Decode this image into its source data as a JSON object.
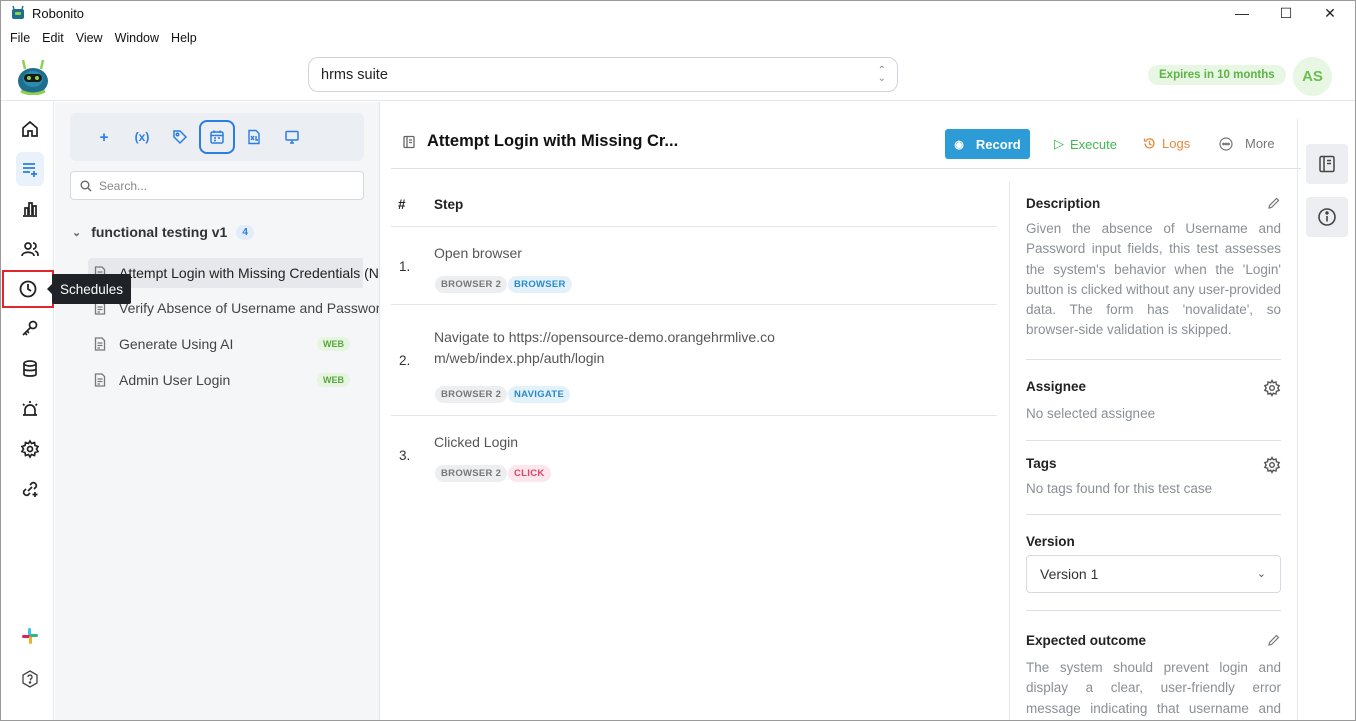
{
  "window": {
    "title": "Robonito",
    "minimize": "—",
    "maximize": "☐",
    "close": "✕"
  },
  "menu": [
    "File",
    "Edit",
    "View",
    "Window",
    "Help"
  ],
  "header": {
    "suite_value": "hrms suite",
    "expires": "Expires in 10 months",
    "avatar": "AS"
  },
  "rail": {
    "tooltip": "Schedules"
  },
  "tree": {
    "search_placeholder": "Search...",
    "group": {
      "name": "functional testing v1",
      "count": "4"
    },
    "items": [
      {
        "label": "Attempt Login with Missing Credentials (No",
        "badge": ""
      },
      {
        "label": "Verify Absence of Username and Password",
        "badge": ""
      },
      {
        "label": "Generate Using AI",
        "badge": "WEB"
      },
      {
        "label": "Admin User Login",
        "badge": "WEB"
      }
    ],
    "toolbar": {
      "add": "+",
      "variable": "(x)"
    }
  },
  "main": {
    "title": "Attempt Login with Missing Cr...",
    "record": "Record",
    "execute": "Execute",
    "logs": "Logs",
    "more": "More",
    "col_num": "#",
    "col_step": "Step",
    "steps": [
      {
        "num": "1.",
        "text": "Open browser",
        "chip1": "BROWSER 2",
        "chip2": "BROWSER"
      },
      {
        "num": "2.",
        "text": "Navigate to https://opensource-demo.orangehrmlive.com/web/index.php/auth/login",
        "chip1": "BROWSER 2",
        "chip2": "NAVIGATE"
      },
      {
        "num": "3.",
        "text": "Clicked Login",
        "chip1": "BROWSER 2",
        "chip2": "CLICK"
      }
    ]
  },
  "details": {
    "description_h": "Description",
    "description": "Given the absence of Username and Password input fields, this test assesses the system's behavior when the 'Login' button is clicked without any user-provided data. The form has 'novalidate', so browser-side validation is skipped.",
    "assignee_h": "Assignee",
    "assignee": "No selected assignee",
    "tags_h": "Tags",
    "tags": "No tags found for this test case",
    "version_h": "Version",
    "version": "Version 1",
    "outcome_h": "Expected outcome",
    "outcome": "The system should prevent login and display a clear, user-friendly error message indicating that username and password are required."
  },
  "colors": {
    "accent": "#2a7de1",
    "record": "#2d9bd6",
    "execute": "#3fb950",
    "logs": "#e8883a",
    "highlight": "#e0262b"
  }
}
